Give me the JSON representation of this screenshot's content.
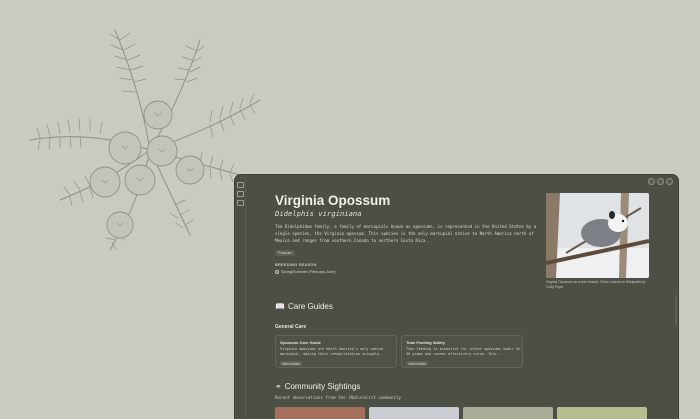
{
  "toolbar": {
    "icons": [
      "panel-icon",
      "search-icon",
      "settings-icon"
    ]
  },
  "species": {
    "common_name": "Virginia Opossum",
    "scientific_name": "Didelphis virginiana",
    "description": "The Didelphidae family, a family of marsupials known as opossums, is represented in the United States by a single species, the Virginia opossum. This species is the only marsupial native to North America north of Mexico and ranges from southern Canada to northern Costa Rica.",
    "tag": "Possum",
    "breeding_label": "BREEDING SEASON",
    "breeding_value": "Spring/Summer (February-June)",
    "photo_caption": "Virginia Opossum on a tree branch. Photo shared on Wikipedia by Cody Pope."
  },
  "care": {
    "heading": "Care Guides",
    "subheading": "General Care",
    "cards": [
      {
        "title": "Opossum Care Guide",
        "desc": "Virginia opossums are North America's only native marsupial, making their rehabilitation uniquely...",
        "level": "Intermediate"
      },
      {
        "title": "Tube Feeding Safety",
        "desc": "Tube feeding is essential for infant opossums under 20-30 grams who cannot effectively nurse. This...",
        "level": "Intermediate"
      }
    ]
  },
  "community": {
    "heading": "Community Sightings",
    "subtitle": "Recent observations from the iNaturalist community"
  },
  "colors": {
    "background": "#c7cbc0",
    "panel": "#4c5044",
    "text": "#eef0e8"
  }
}
